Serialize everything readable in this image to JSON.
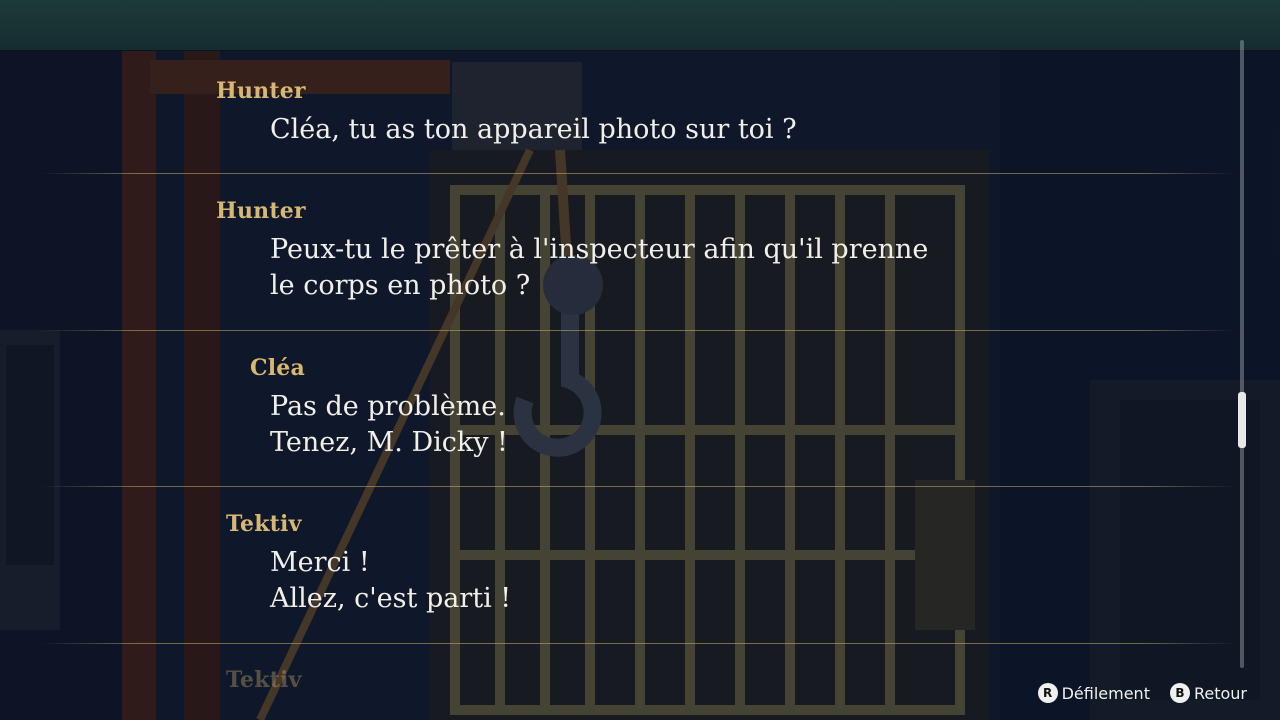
{
  "backlog": {
    "entries": [
      {
        "speaker": "Hunter",
        "lines": [
          "Cléa, tu as ton appareil photo sur toi ?"
        ]
      },
      {
        "speaker": "Hunter",
        "lines": [
          "Peux-tu le prêter à l'inspecteur afin qu'il prenne",
          "le corps en photo ?"
        ]
      },
      {
        "speaker": "Cléa",
        "lines": [
          "Pas de problème.",
          "Tenez, M. Dicky !"
        ]
      },
      {
        "speaker": "Tektiv",
        "lines": [
          "Merci !",
          "Allez, c'est parti !"
        ]
      },
      {
        "speaker": "Tektiv",
        "lines": []
      }
    ]
  },
  "controls": {
    "scroll": {
      "glyph": "R",
      "label": "Défilement"
    },
    "back": {
      "glyph": "B",
      "label": "Retour"
    }
  },
  "colors": {
    "speaker": "#d7b873",
    "text": "#f2efe8",
    "background": "#0f1626"
  },
  "scroll_position": 0.66
}
